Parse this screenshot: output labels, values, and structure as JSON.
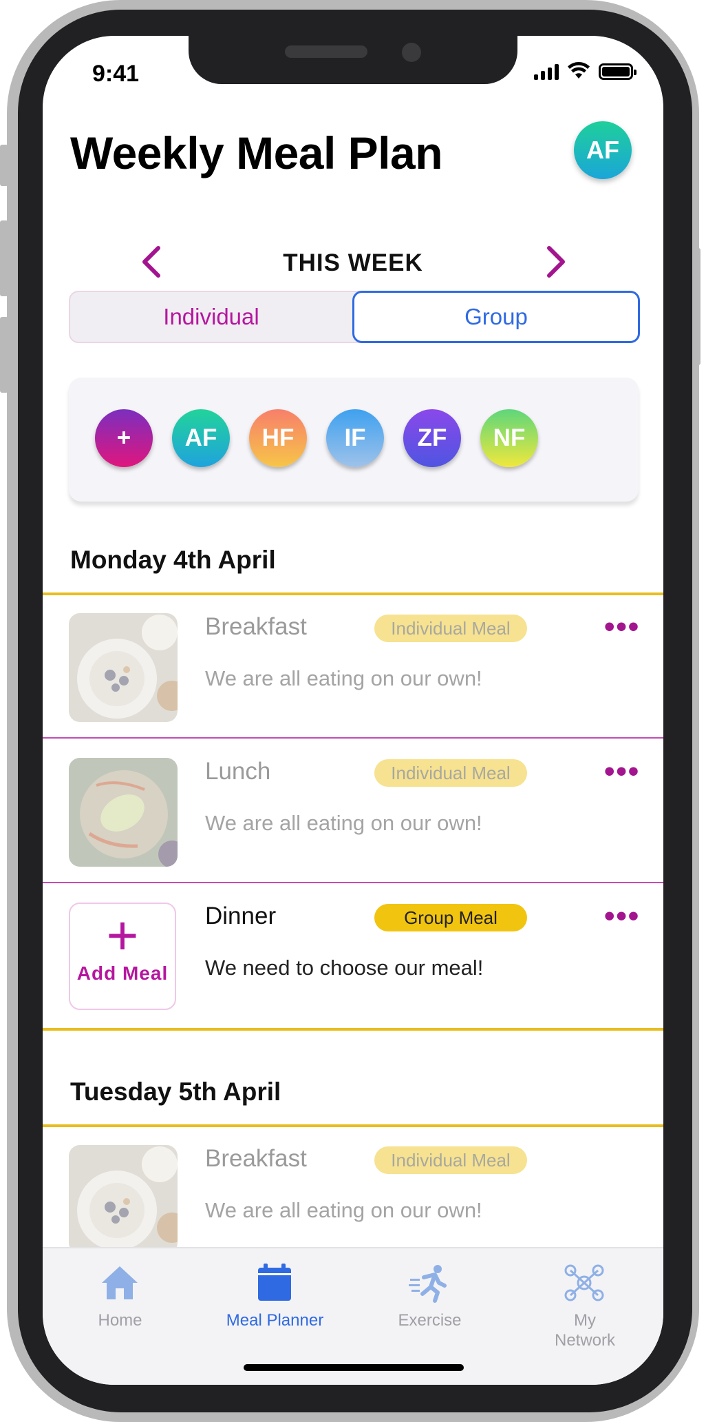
{
  "status_bar": {
    "time": "9:41"
  },
  "header": {
    "title": "Weekly Meal Plan",
    "user_initials": "AF"
  },
  "week_nav": {
    "label": "THIS WEEK"
  },
  "segment": {
    "individual": "Individual",
    "group": "Group",
    "selected": "Group"
  },
  "members": [
    {
      "initials": "+",
      "color": "#c11d8e"
    },
    {
      "initials": "AF",
      "color": "#1fb7c7"
    },
    {
      "initials": "HF",
      "color": "#f49a6d"
    },
    {
      "initials": "IF",
      "color": "#5aa6e8"
    },
    {
      "initials": "ZF",
      "color": "#6b4bdf"
    },
    {
      "initials": "NF",
      "color": "#a7e05a"
    }
  ],
  "days": [
    {
      "label": "Monday 4th April",
      "meals": [
        {
          "name": "Breakfast",
          "badge": "Individual Meal",
          "description": "We are all eating on our own!"
        },
        {
          "name": "Lunch",
          "badge": "Individual Meal",
          "description": "We are all eating on our own!"
        },
        {
          "name": "Dinner",
          "badge": "Group Meal",
          "description": "We need to choose our meal!",
          "add_label": "Add Meal"
        }
      ]
    },
    {
      "label": "Tuesday 5th April",
      "meals": [
        {
          "name": "Breakfast",
          "badge": "Individual Meal",
          "description": "We are all eating on our own!"
        }
      ]
    }
  ],
  "tabbar": {
    "items": [
      {
        "label": "Home",
        "icon": "home-icon"
      },
      {
        "label": "Meal Planner",
        "icon": "calendar-icon",
        "active": true
      },
      {
        "label": "Exercise",
        "icon": "running-icon"
      },
      {
        "label": "My Network",
        "icon": "network-icon"
      }
    ],
    "active_color": "#2f6ae2",
    "inactive_color": "#a0a0a6"
  },
  "colors": {
    "accent": "#a3148f",
    "yellow": "#e8bd1f",
    "badge_individual": "#f6e290",
    "badge_group": "#f1c40f"
  }
}
